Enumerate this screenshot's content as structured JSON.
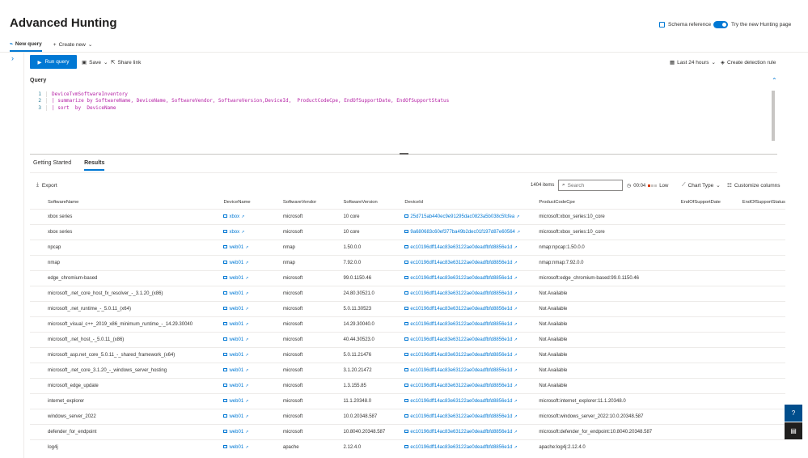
{
  "page": {
    "title": "Advanced Hunting"
  },
  "header": {
    "schema_reference": "Schema reference",
    "toggle_label": "Try the new Hunting page"
  },
  "tabs": {
    "new_query": "New query",
    "create_new": "Create new"
  },
  "toolbar": {
    "run_query": "Run query",
    "save": "Save",
    "share_link": "Share link",
    "time_range": "Last 24 hours",
    "create_detection_rule": "Create detection rule"
  },
  "query": {
    "label": "Query",
    "lines": [
      {
        "num": "1",
        "text": "DeviceTvmSoftwareInventory"
      },
      {
        "num": "2",
        "text": "| summarize by SoftwareName, DeviceName, SoftwareVendor, SoftwareVersion,DeviceId,  ProductCodeCpe, EndOfSupportDate, EndOfSupportStatus"
      },
      {
        "num": "3",
        "text": "| sort  by  DeviceName"
      }
    ]
  },
  "results_tabs": {
    "getting_started": "Getting Started",
    "results": "Results"
  },
  "results_toolbar": {
    "export": "Export",
    "items_count": "1404 items",
    "search_placeholder": "Search",
    "timer": "00:04",
    "low_label": "Low",
    "chart_type": "Chart Type",
    "customize_columns": "Customize columns"
  },
  "table": {
    "columns": [
      "SoftwareName",
      "DeviceName",
      "SoftwareVendor",
      "SoftwareVersion",
      "DeviceId",
      "ProductCodeCpe",
      "EndOfSupportDate",
      "EndOfSupportStatus"
    ],
    "rows": [
      [
        "xbox series",
        "xbox",
        "microsoft",
        "10 core",
        "25d715ab440ec9e91295dac0823a5b038c5fcfea",
        "microsoft:xbox_series:10_core"
      ],
      [
        "xbox series",
        "xbox",
        "microsoft",
        "10 core",
        "9a680683c60ef377ba49b2dec01f197d87e60564",
        "microsoft:xbox_series:10_core"
      ],
      [
        "npcap",
        "web01",
        "nmap",
        "1.50.0.0",
        "ec10196dff14ac83e63122ae0deadfbfd8856e1d",
        "nmap:npcap:1.50.0.0"
      ],
      [
        "nmap",
        "web01",
        "nmap",
        "7.92.0.0",
        "ec10196dff14ac83e63122ae0deadfbfd8856e1d",
        "nmap:nmap:7.92.0.0"
      ],
      [
        "edge_chromium-based",
        "web01",
        "microsoft",
        "99.0.1150.46",
        "ec10196dff14ac83e63122ae0deadfbfd8856e1d",
        "microsoft:edge_chromium-based:99.0.1150.46"
      ],
      [
        "microsoft_.net_core_host_fx_resolver_-_3.1.20_(x86)",
        "web01",
        "microsoft",
        "24.80.30521.0",
        "ec10196dff14ac83e63122ae0deadfbfd8856e1d",
        "Not Available"
      ],
      [
        "microsoft_.net_runtime_-_5.0.11_(x64)",
        "web01",
        "microsoft",
        "5.0.11.30523",
        "ec10196dff14ac83e63122ae0deadfbfd8856e1d",
        "Not Available"
      ],
      [
        "microsoft_visual_c++_2019_x86_minimum_runtime_-_14.29.30040",
        "web01",
        "microsoft",
        "14.29.30040.0",
        "ec10196dff14ac83e63122ae0deadfbfd8856e1d",
        "Not Available"
      ],
      [
        "microsoft_.net_host_-_5.0.11_(x86)",
        "web01",
        "microsoft",
        "40.44.30523.0",
        "ec10196dff14ac83e63122ae0deadfbfd8856e1d",
        "Not Available"
      ],
      [
        "microsoft_asp.net_core_5.0.11_-_shared_framework_(x64)",
        "web01",
        "microsoft",
        "5.0.11.21476",
        "ec10196dff14ac83e63122ae0deadfbfd8856e1d",
        "Not Available"
      ],
      [
        "microsoft_.net_core_3.1.20_-_windows_server_hosting",
        "web01",
        "microsoft",
        "3.1.20.21472",
        "ec10196dff14ac83e63122ae0deadfbfd8856e1d",
        "Not Available"
      ],
      [
        "microsoft_edge_update",
        "web01",
        "microsoft",
        "1.3.155.85",
        "ec10196dff14ac83e63122ae0deadfbfd8856e1d",
        "Not Available"
      ],
      [
        "internet_explorer",
        "web01",
        "microsoft",
        "11.1.20348.0",
        "ec10196dff14ac83e63122ae0deadfbfd8856e1d",
        "microsoft:internet_explorer:11.1.20348.0"
      ],
      [
        "windows_server_2022",
        "web01",
        "microsoft",
        "10.0.20348.587",
        "ec10196dff14ac83e63122ae0deadfbfd8856e1d",
        "microsoft:windows_server_2022:10.0.20348.587"
      ],
      [
        "defender_for_endpoint",
        "web01",
        "microsoft",
        "10.8040.20348.587",
        "ec10196dff14ac83e63122ae0deadfbfd8856e1d",
        "microsoft:defender_for_endpoint:10.8040.20348.587"
      ],
      [
        "log4j",
        "web01",
        "apache",
        "2.12.4.0",
        "ec10196dff14ac83e63122ae0deadfbfd8856e1d",
        "apache:log4j:2.12.4.0"
      ]
    ]
  },
  "colors": {
    "accent": "#0078d4",
    "link": "#0078d4",
    "float_button": "#004e8c"
  }
}
